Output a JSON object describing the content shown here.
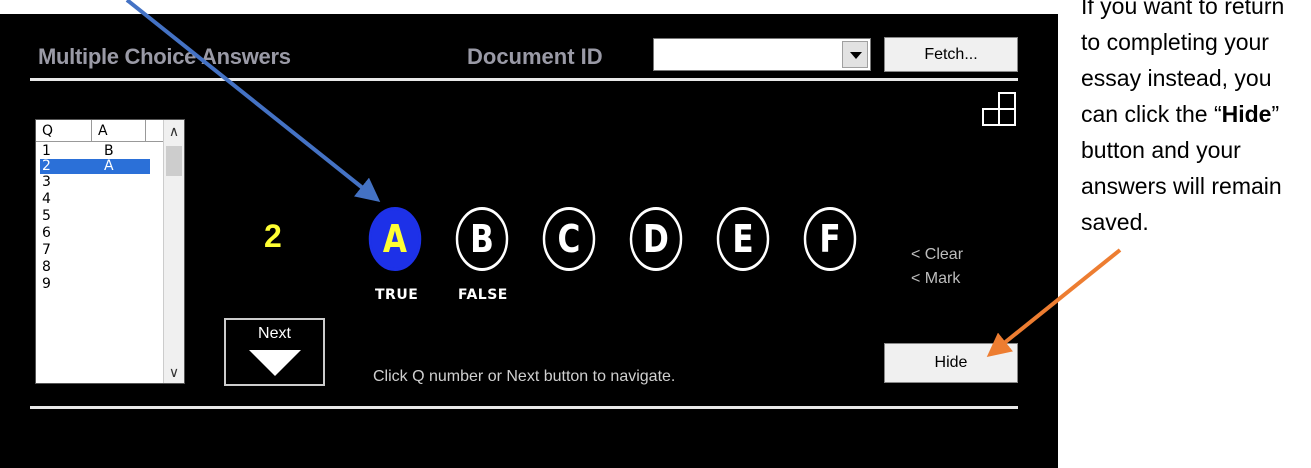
{
  "header": {
    "title": "Multiple Choice Answers",
    "doc_id_label": "Document ID",
    "doc_id_value": "",
    "fetch_label": "Fetch..."
  },
  "list": {
    "headers": [
      "Q",
      "A"
    ],
    "rows": [
      {
        "q": "1",
        "a": "B"
      },
      {
        "q": "2",
        "a": "A"
      },
      {
        "q": "3",
        "a": ""
      },
      {
        "q": "4",
        "a": ""
      },
      {
        "q": "5",
        "a": ""
      },
      {
        "q": "6",
        "a": ""
      },
      {
        "q": "7",
        "a": ""
      },
      {
        "q": "8",
        "a": ""
      },
      {
        "q": "9",
        "a": ""
      }
    ],
    "selected_index": 1
  },
  "question": {
    "number": "2",
    "choices": [
      "A",
      "B",
      "C",
      "D",
      "E",
      "F"
    ],
    "selected": "A",
    "true_label": "TRUE",
    "false_label": "FALSE"
  },
  "controls": {
    "clear_label": "< Clear",
    "mark_label": "< Mark",
    "next_label": "Next",
    "hint": "Click Q number or Next button to navigate.",
    "hide_label": "Hide"
  },
  "annotation": {
    "text_before": "If you want to return to completing your essay instead, you can click the “",
    "bold": "Hide",
    "text_after": "” button and your answers will remain saved."
  },
  "colors": {
    "selected_choice": "#1d31e8",
    "accent_yellow": "#ffff33",
    "arrow_blue": "#4472c4",
    "arrow_orange": "#ed7d31"
  }
}
